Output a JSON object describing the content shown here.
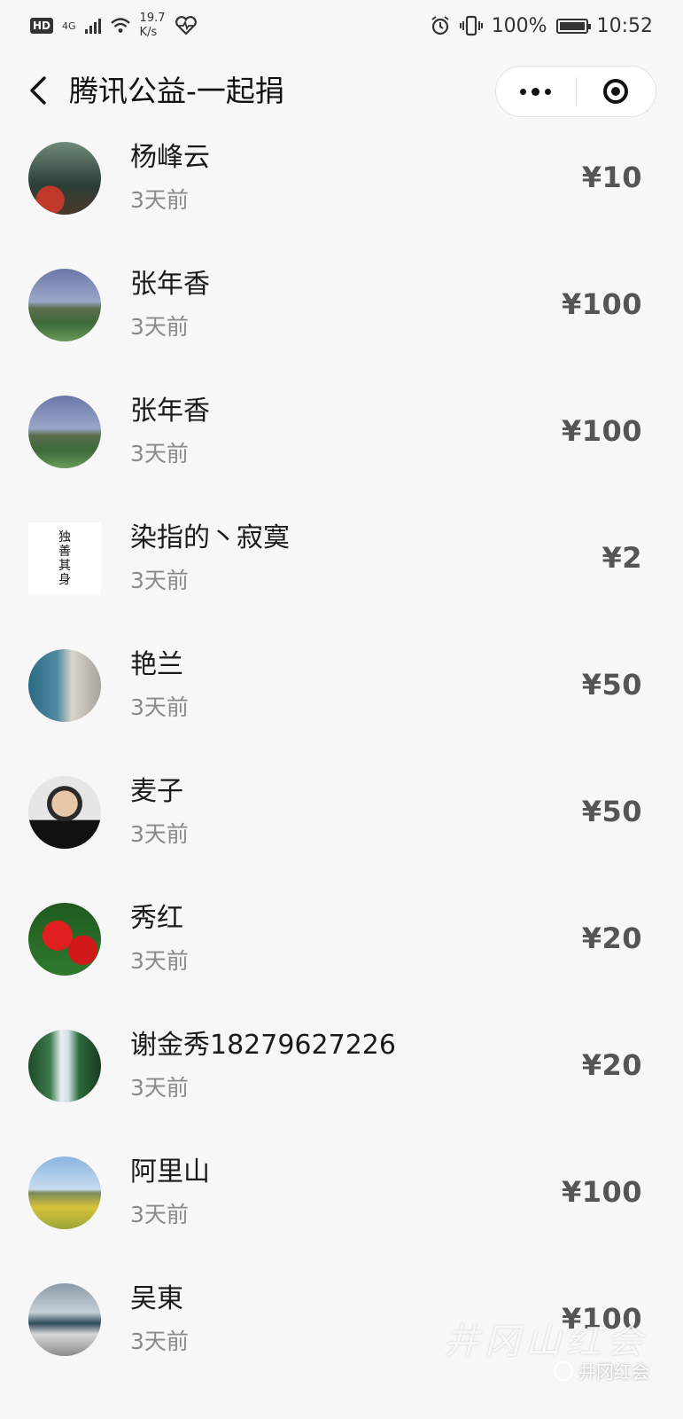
{
  "status_bar": {
    "hd": "HD",
    "network": "4G",
    "speed_value": "19.7",
    "speed_unit": "K/s",
    "battery": "100%",
    "time": "10:52"
  },
  "header": {
    "title": "腾讯公益-一起捐"
  },
  "donors": [
    {
      "name": "杨峰云",
      "time": "3天前",
      "amount": "¥10"
    },
    {
      "name": "张年香",
      "time": "3天前",
      "amount": "¥100"
    },
    {
      "name": "张年香",
      "time": "3天前",
      "amount": "¥100"
    },
    {
      "name": "染指的丶寂寞",
      "time": "3天前",
      "amount": "¥2"
    },
    {
      "name": "艳兰",
      "time": "3天前",
      "amount": "¥50"
    },
    {
      "name": "麦子",
      "time": "3天前",
      "amount": "¥50"
    },
    {
      "name": "秀红",
      "time": "3天前",
      "amount": "¥20"
    },
    {
      "name": "谢金秀18279627226",
      "time": "3天前",
      "amount": "¥20"
    },
    {
      "name": "阿里山",
      "time": "3天前",
      "amount": "¥100"
    },
    {
      "name": "吴東",
      "time": "3天前",
      "amount": "¥100"
    }
  ],
  "calligraphy_avatar": [
    "独",
    "善",
    "其",
    "身"
  ],
  "watermark": {
    "brush": "井冈山红会",
    "label": "井冈红会"
  }
}
